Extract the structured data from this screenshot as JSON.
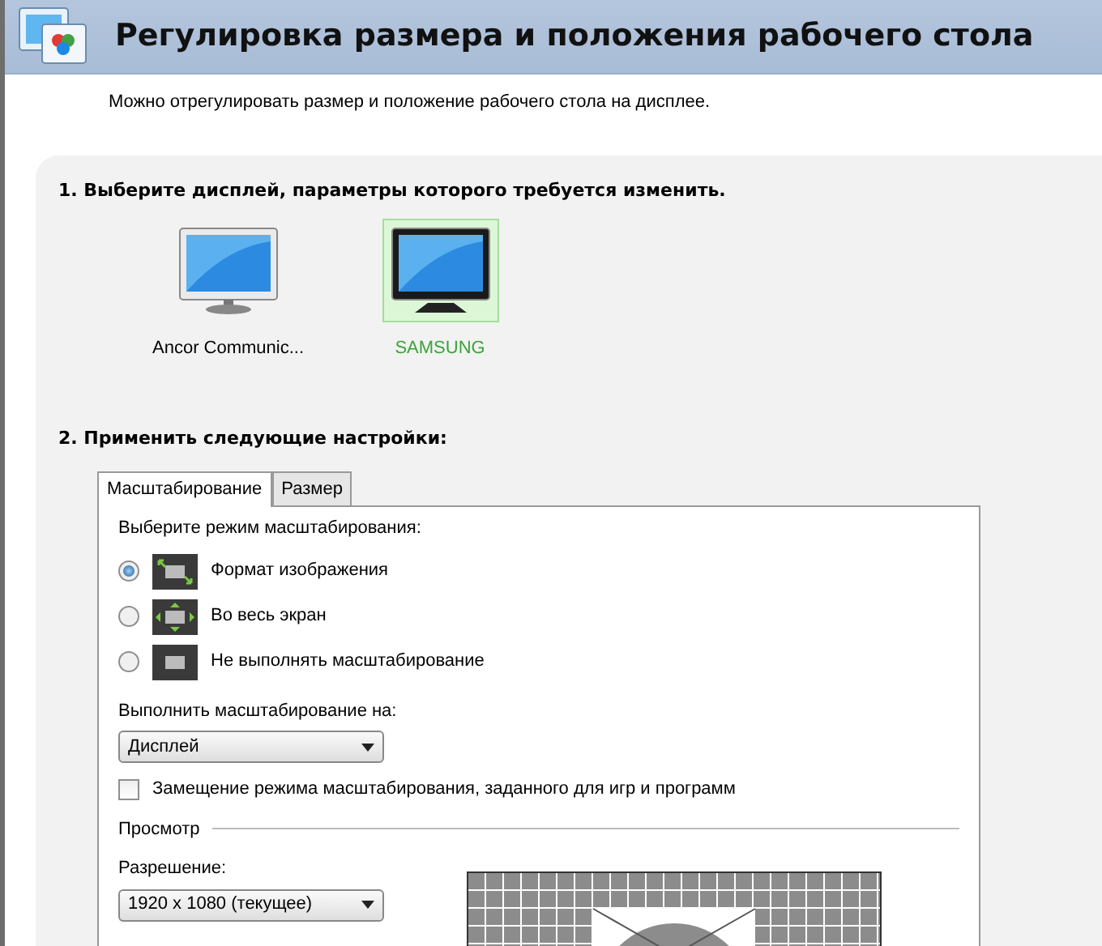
{
  "header": {
    "title": "Регулировка размера и положения рабочего стола",
    "subtitle": "Можно отрегулировать размер и положение рабочего стола на дисплее."
  },
  "step1": {
    "heading": "1. Выберите дисплей, параметры которого требуется изменить.",
    "displays": [
      {
        "name": "Ancor Communic...",
        "kind": "white",
        "selected": false
      },
      {
        "name": "SAMSUNG",
        "kind": "black",
        "selected": true
      }
    ]
  },
  "step2": {
    "heading": "2. Применить следующие настройки:",
    "tabs": [
      {
        "label": "Масштабирование",
        "selected": true
      },
      {
        "label": "Размер",
        "selected": false
      }
    ],
    "mode_prompt": "Выберите режим масштабирования:",
    "modes": [
      {
        "label": "Формат изображения",
        "kind": "aspect",
        "selected": true
      },
      {
        "label": "Во весь экран",
        "kind": "full",
        "selected": false
      },
      {
        "label": "Не выполнять масштабирование",
        "kind": "none",
        "selected": false
      }
    ],
    "scale_on_label": "Выполнить масштабирование на:",
    "scale_on_value": "Дисплей",
    "override": {
      "label": "Замещение режима масштабирования, заданного для игр и программ",
      "checked": false
    },
    "preview_label": "Просмотр",
    "resolution_label": "Разрешение:",
    "resolution_value": "1920 x 1080 (текущее)"
  }
}
